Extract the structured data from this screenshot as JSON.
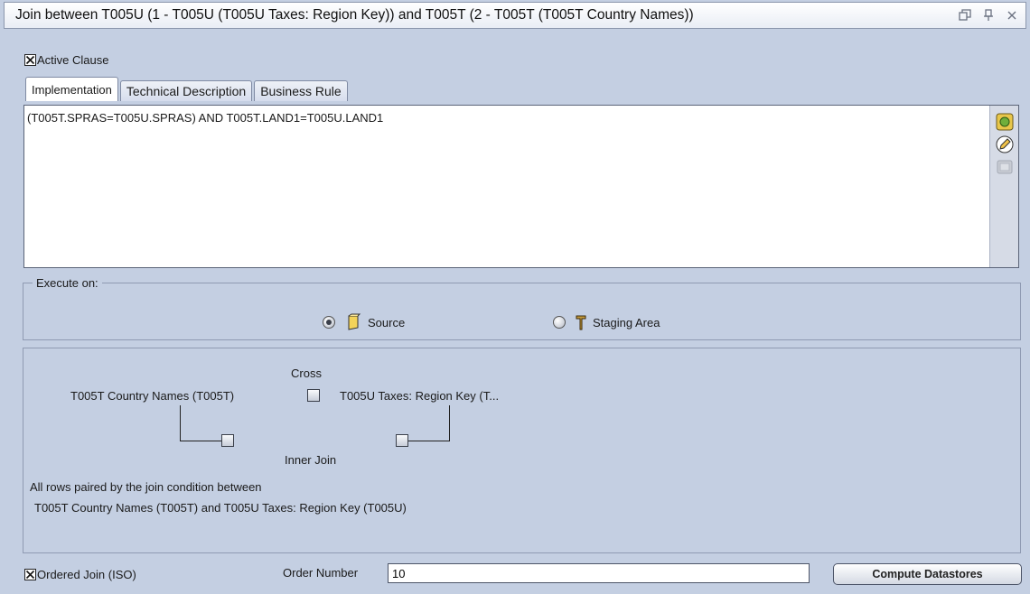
{
  "window": {
    "title": "Join between T005U (1 - T005U (T005U Taxes: Region Key)) and T005T (2 - T005T (T005T Country Names))",
    "controls": [
      "restore-icon",
      "pin-icon",
      "close-icon"
    ]
  },
  "active_clause": {
    "label": "Active Clause",
    "checked": true
  },
  "tabs": [
    {
      "label": "Implementation",
      "active": true
    },
    {
      "label": "Technical Description",
      "active": false
    },
    {
      "label": "Business Rule",
      "active": false
    }
  ],
  "editor": {
    "text": "(T005T.SPRAS=T005U.SPRAS) AND T005T.LAND1=T005U.LAND1",
    "tools": [
      "expression-editor-icon",
      "edit-pencil-icon",
      "disabled-tool-icon"
    ]
  },
  "execute_on": {
    "label": "Execute on:",
    "options": [
      {
        "label": "Source",
        "icon": "source-icon",
        "selected": true
      },
      {
        "label": "Staging Area",
        "icon": "staging-area-icon",
        "selected": false
      }
    ]
  },
  "join": {
    "cross_label": "Cross",
    "left_table": "T005T Country Names (T005T)",
    "right_table": "T005U Taxes: Region Key (T...",
    "inner_join_label": "Inner Join",
    "description_line1": "All rows paired by the join condition between",
    "description_line2": "T005T Country Names (T005T) and T005U Taxes: Region Key (T005U)"
  },
  "ordered_join": {
    "label": "Ordered Join (ISO)",
    "checked": true
  },
  "order_number": {
    "label": "Order Number",
    "value": "10"
  },
  "compute_button": {
    "label": "Compute Datastores"
  }
}
